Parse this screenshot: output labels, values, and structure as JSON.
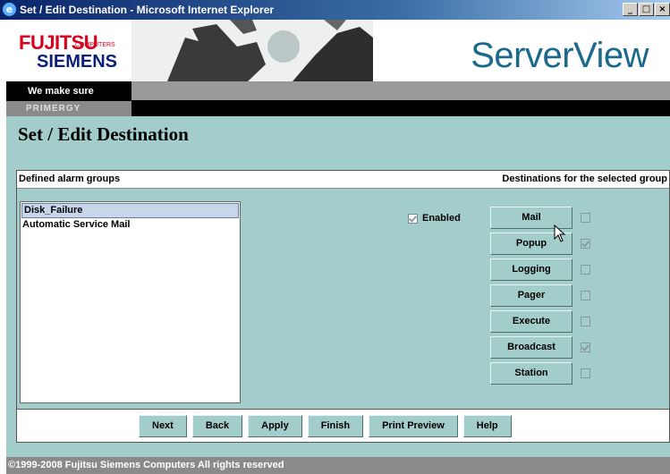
{
  "window": {
    "title": "Set / Edit Destination - Microsoft Internet Explorer",
    "icon": "ie-icon",
    "controls": [
      "_",
      "□",
      "×"
    ]
  },
  "banner": {
    "logo_brand": "FUJITSU",
    "logo_sub": "COMPUTERS",
    "logo_brand2": "SIEMENS",
    "product": "ServerView",
    "tagline": "We make sure",
    "line": "PRIMERGY"
  },
  "page": {
    "title": "Set / Edit Destination",
    "left_header": "Defined alarm groups",
    "right_header": "Destinations for the selected group",
    "groups": [
      {
        "label": "Disk_Failure",
        "selected": true
      },
      {
        "label": "Automatic Service Mail",
        "selected": false
      }
    ],
    "enabled": {
      "label": "Enabled",
      "checked": true
    },
    "destinations": [
      {
        "label": "Mail",
        "checked": false
      },
      {
        "label": "Popup",
        "checked": true
      },
      {
        "label": "Logging",
        "checked": false
      },
      {
        "label": "Pager",
        "checked": false
      },
      {
        "label": "Execute",
        "checked": false
      },
      {
        "label": "Broadcast",
        "checked": true
      },
      {
        "label": "Station",
        "checked": false
      }
    ]
  },
  "buttons": {
    "next": "Next",
    "back": "Back",
    "apply": "Apply",
    "finish": "Finish",
    "print_preview": "Print Preview",
    "help": "Help"
  },
  "footer": {
    "text": "©1999-2008  Fujitsu Siemens Computers  All rights reserved"
  }
}
